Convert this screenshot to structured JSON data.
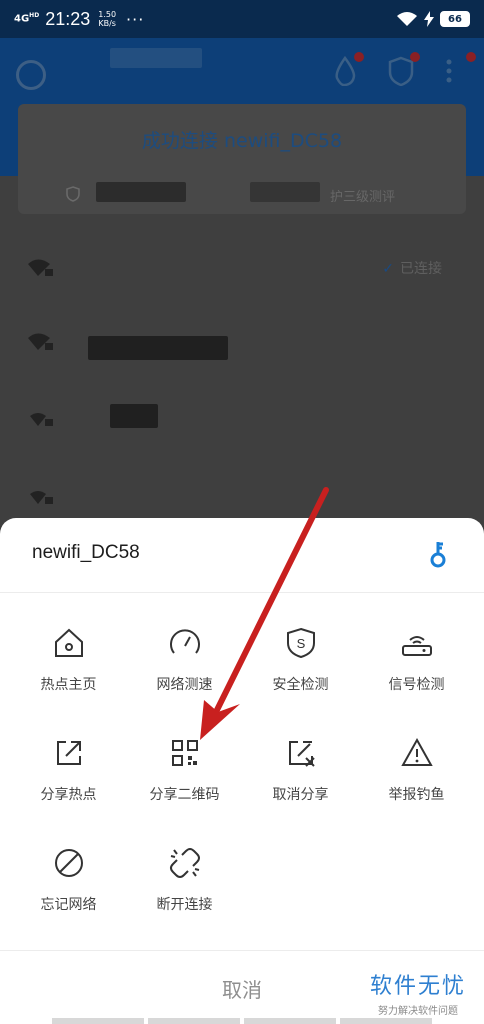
{
  "status_bar": {
    "network": "4G",
    "network_sub": "HD",
    "time": "21:23",
    "speed_value": "1.50",
    "speed_unit": "KB/s",
    "overflow": "···",
    "battery": "66"
  },
  "background": {
    "connected_title": "成功连接 newifi_DC58",
    "protection_text": "护三级测评",
    "connected_status": "已连接",
    "check_glyph": "✓"
  },
  "sheet": {
    "title": "newifi_DC58",
    "items": [
      {
        "label": "热点主页",
        "icon": "home-icon"
      },
      {
        "label": "网络测速",
        "icon": "speedometer-icon"
      },
      {
        "label": "安全检测",
        "icon": "shield-s-icon"
      },
      {
        "label": "信号检测",
        "icon": "router-icon"
      },
      {
        "label": "分享热点",
        "icon": "share-icon"
      },
      {
        "label": "分享二维码",
        "icon": "qr-code-icon"
      },
      {
        "label": "取消分享",
        "icon": "cancel-share-icon"
      },
      {
        "label": "举报钓鱼",
        "icon": "warning-icon"
      },
      {
        "label": "忘记网络",
        "icon": "forget-icon"
      },
      {
        "label": "断开连接",
        "icon": "disconnect-icon"
      }
    ],
    "cancel": "取消"
  },
  "watermark": {
    "title": "软件无忧",
    "subtitle": "努力解决软件问题"
  },
  "colors": {
    "accent": "#1a7fd6",
    "annotation_arrow": "#c8201f"
  }
}
